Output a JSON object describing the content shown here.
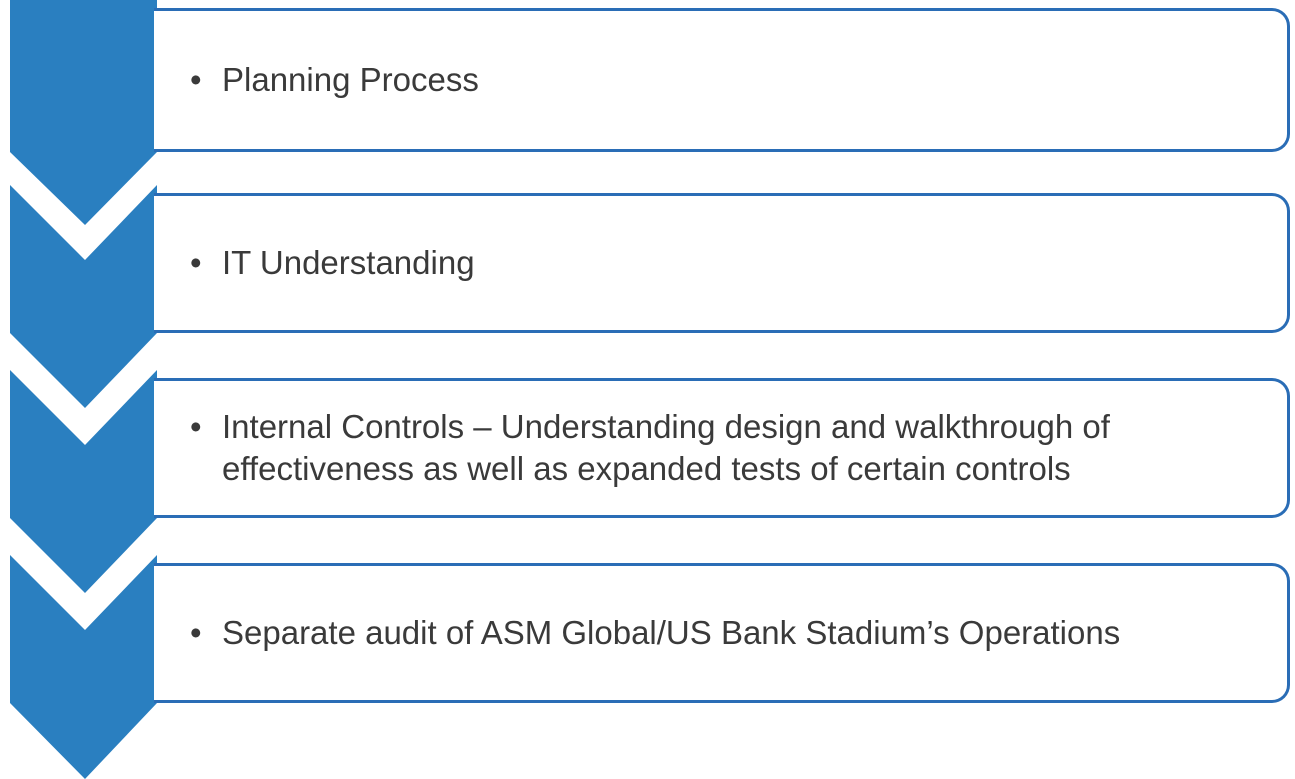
{
  "colors": {
    "chevron_fill": "#2a7fc0",
    "box_border": "#2a6db6",
    "text": "#3a3a3a"
  },
  "bullet_glyph": "•",
  "steps": [
    {
      "text": "Planning Process"
    },
    {
      "text": "IT Understanding"
    },
    {
      "text": "Internal Controls – Understanding design and walkthrough of effectiveness as well as expanded tests of certain controls"
    },
    {
      "text": "Separate audit of ASM Global/US Bank Stadium’s Operations"
    }
  ]
}
